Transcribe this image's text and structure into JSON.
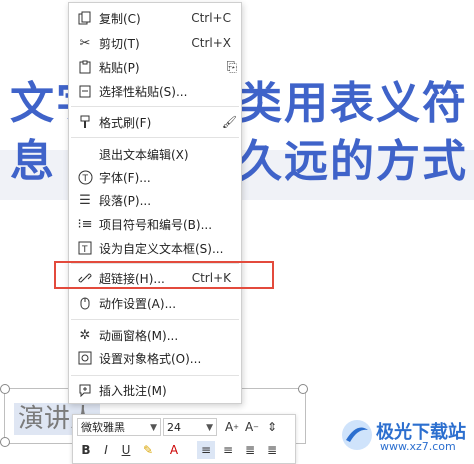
{
  "slide": {
    "line1_left": "文字",
    "line1_right": "类用表义符",
    "line2_left": "息",
    "line2_right": "久远的方式",
    "lower_text": "演讲人"
  },
  "menu": {
    "items": [
      {
        "label": "复制(C)",
        "shortcut": "Ctrl+C",
        "icon": "copy-icon"
      },
      {
        "label": "剪切(T)",
        "shortcut": "Ctrl+X",
        "icon": "cut-icon"
      },
      {
        "label": "粘贴(P)",
        "shortcut": "",
        "icon": "paste-icon"
      },
      {
        "label": "选择性粘贴(S)...",
        "shortcut": "",
        "icon": "paste-special-icon"
      },
      {
        "label": "格式刷(F)",
        "shortcut": "",
        "icon": "format-painter-icon"
      },
      {
        "label": "退出文本编辑(X)",
        "shortcut": "",
        "icon": ""
      },
      {
        "label": "字体(F)...",
        "shortcut": "",
        "icon": "font-icon"
      },
      {
        "label": "段落(P)...",
        "shortcut": "",
        "icon": "paragraph-icon"
      },
      {
        "label": "项目符号和编号(B)...",
        "shortcut": "",
        "icon": "bullets-icon"
      },
      {
        "label": "设为自定义文本框(S)...",
        "shortcut": "",
        "icon": "textbox-icon"
      },
      {
        "label": "超链接(H)...",
        "shortcut": "Ctrl+K",
        "icon": "hyperlink-icon"
      },
      {
        "label": "动作设置(A)...",
        "shortcut": "",
        "icon": "action-icon"
      },
      {
        "label": "动画窗格(M)...",
        "shortcut": "",
        "icon": "animation-pane-icon"
      },
      {
        "label": "设置对象格式(O)...",
        "shortcut": "",
        "icon": "object-format-icon"
      },
      {
        "label": "插入批注(M)",
        "shortcut": "",
        "icon": "comment-icon"
      }
    ]
  },
  "toolbar": {
    "font_name": "微软雅黑",
    "font_size": "24"
  },
  "watermark": {
    "name": "极光下载站",
    "url": "www.xz7.com"
  },
  "colors": {
    "accent": "#3f63c9",
    "highlight_border": "#e34a3c"
  }
}
